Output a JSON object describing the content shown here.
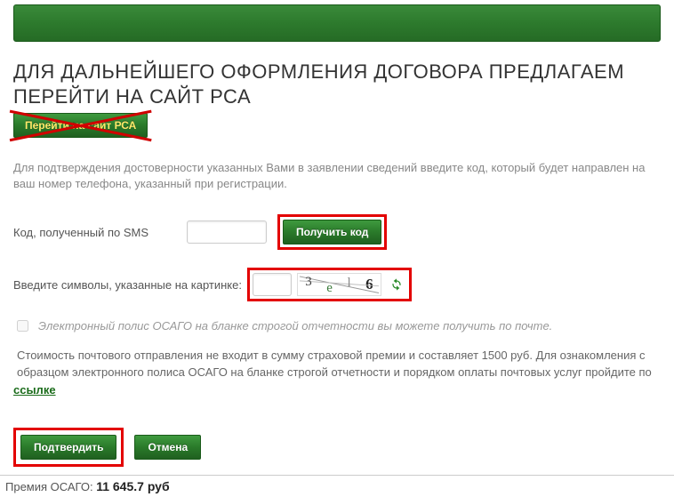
{
  "title": "ДЛЯ ДАЛЬНЕЙШЕГО ОФОРМЛЕНИЯ ДОГОВОРА ПРЕДЛАГАЕМ ПЕРЕЙТИ НА САЙТ РСА",
  "rsa_button_label": "Перейти на сайт РСА",
  "instructions": "Для подтверждения достоверности указанных Вами в заявлении сведений введите код, который будет направлен на ваш номер телефона, указанный при регистрации.",
  "sms": {
    "label": "Код, полученный по SMS",
    "value": "",
    "get_code_label": "Получить код"
  },
  "captcha": {
    "label": "Введите символы, указанные на картинке:",
    "value": "",
    "chars": [
      "3",
      "e",
      "l",
      "6"
    ]
  },
  "checkbox_label": "Электронный полис ОСАГО на бланке строгой отчетности вы можете получить по почте.",
  "note": "Стоимость почтового отправления не входит в сумму страховой премии и составляет 1500 руб. Для ознакомления с образцом электронного полиса ОСАГО на бланке строгой отчетности и порядком оплаты почтовых услуг пройдите по ",
  "link_label": "ссылке",
  "actions": {
    "confirm": "Подтвердить",
    "cancel": "Отмена"
  },
  "footer": {
    "label": "Премия ОСАГО:",
    "value": "11 645.7 руб"
  },
  "colors": {
    "highlight": "#e30000",
    "primary": "#2a7a2a"
  }
}
